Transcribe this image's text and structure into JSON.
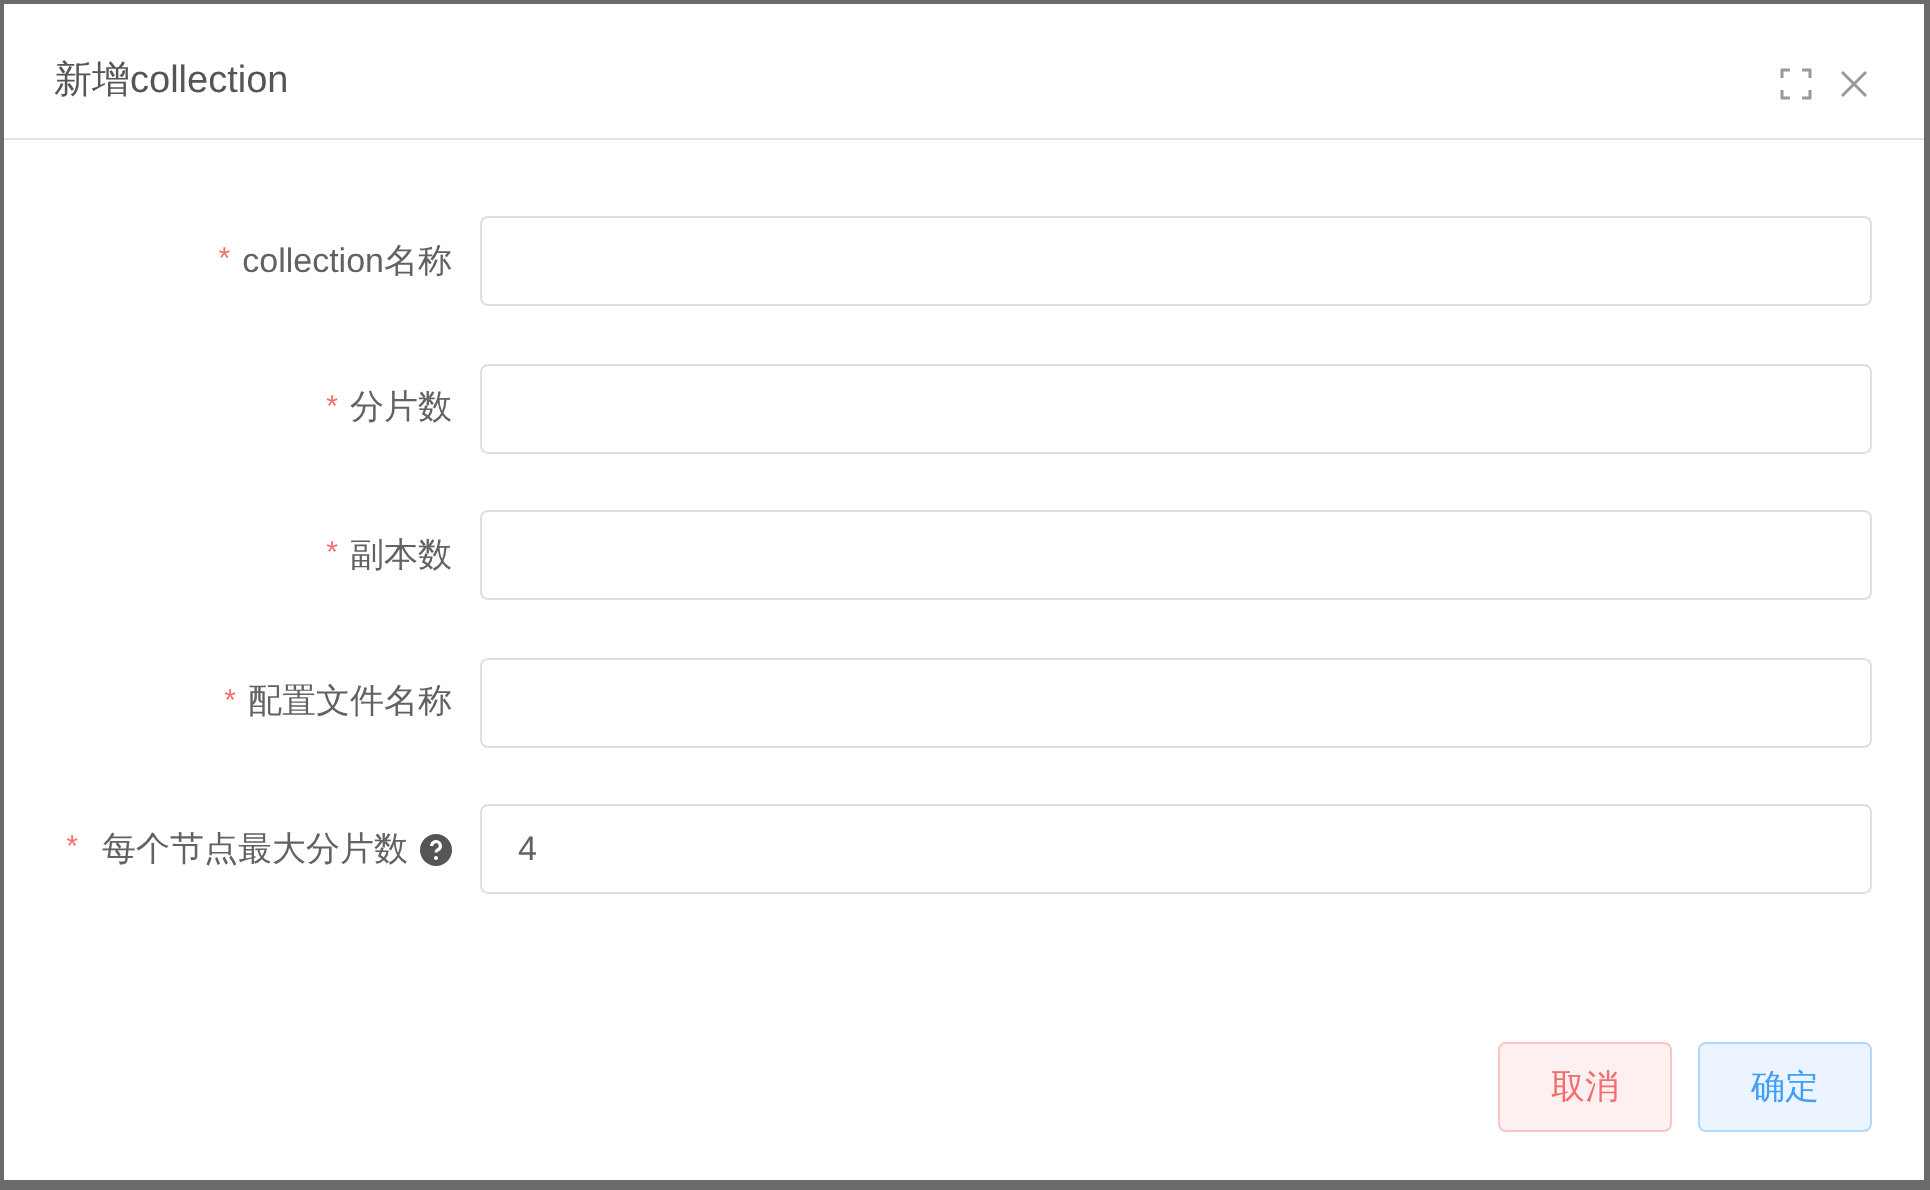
{
  "dialog": {
    "title": "新增collection"
  },
  "fields": [
    {
      "label": "collection名称",
      "required_mark": "*",
      "help": false
    },
    {
      "label": "分片数",
      "required_mark": "*",
      "help": false
    },
    {
      "label": "副本数",
      "required_mark": "*",
      "help": false
    },
    {
      "label": "配置文件名称",
      "required_mark": "*",
      "help": false
    },
    {
      "label": "每个节点最大分片数",
      "required_mark": "*",
      "help": true,
      "value": "4"
    }
  ],
  "buttons": [
    {
      "label": "取消",
      "kind": "cancel"
    },
    {
      "label": "确定",
      "kind": "confirm"
    }
  ]
}
